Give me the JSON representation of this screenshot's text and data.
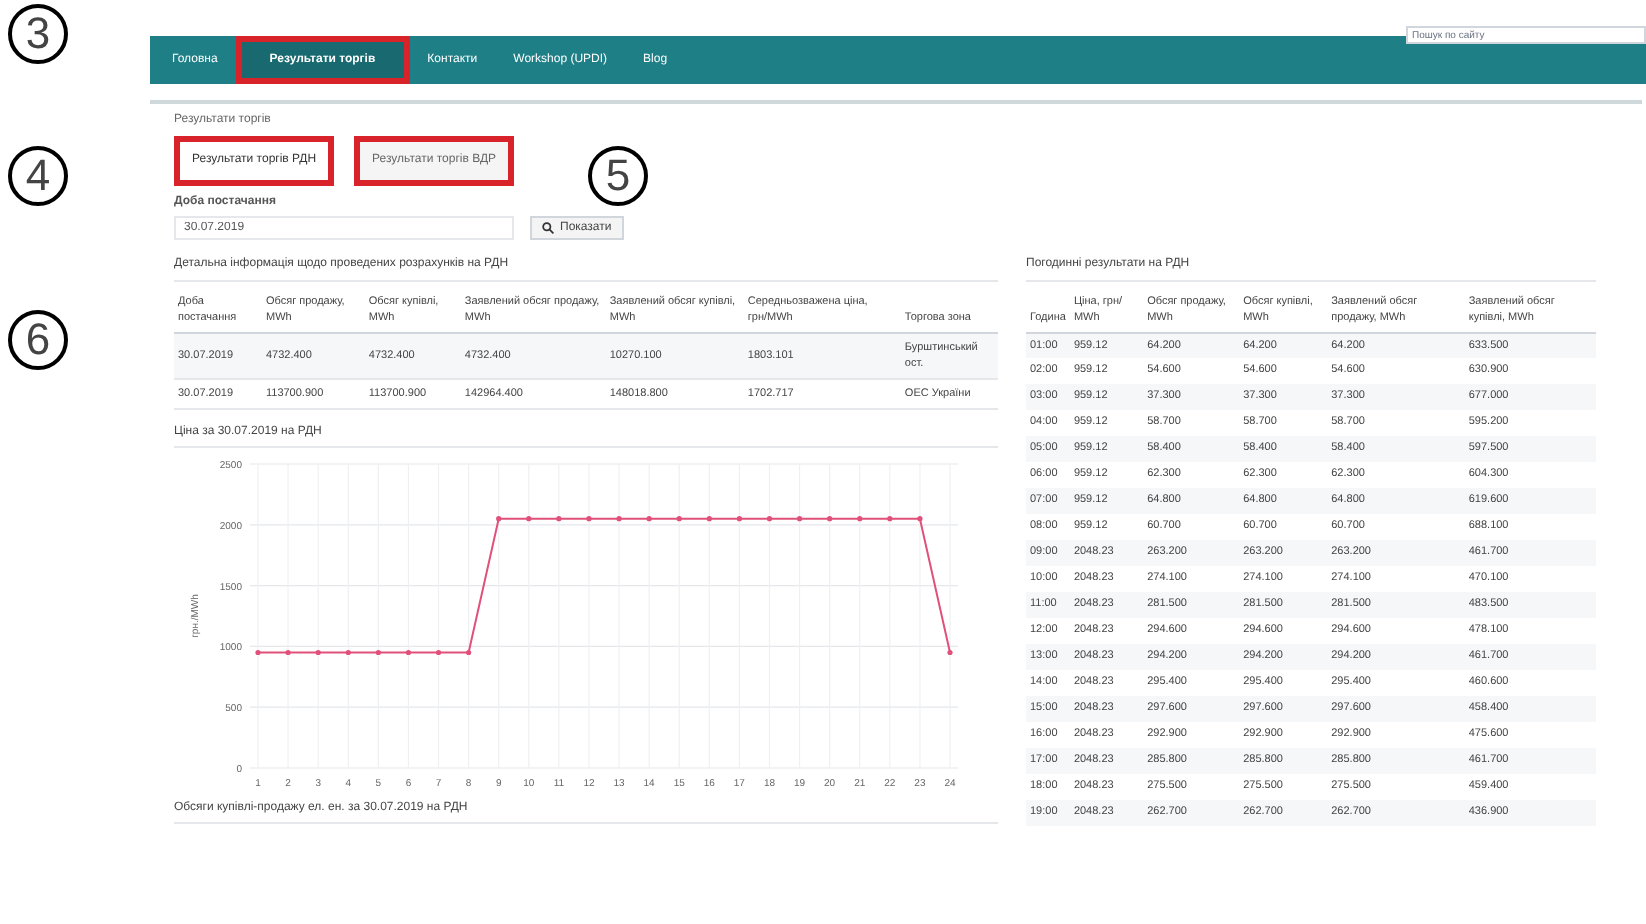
{
  "nav": {
    "items": [
      {
        "label": "Головна",
        "selected": false,
        "highlighted": false
      },
      {
        "label": "Результати торгів",
        "selected": true,
        "highlighted": true
      },
      {
        "label": "Контакти",
        "selected": false,
        "highlighted": false
      },
      {
        "label": "Workshop (UPDI)",
        "selected": false,
        "highlighted": false
      },
      {
        "label": "Blog",
        "selected": false,
        "highlighted": false
      }
    ],
    "search": {
      "placeholder": "Пошук по сайту"
    }
  },
  "annotations": [
    {
      "label": "3"
    },
    {
      "label": "4"
    },
    {
      "label": "5"
    },
    {
      "label": "6"
    }
  ],
  "section_title": "Результати торгів",
  "tabs": [
    {
      "label": "Результати торгів РДН",
      "selected": true,
      "highlighted": true
    },
    {
      "label": "Результати торгів ВДР",
      "selected": false,
      "highlighted": true
    }
  ],
  "date_field": {
    "label": "Доба постачання",
    "value": "30.07.2019"
  },
  "show_button": "Показати",
  "details": {
    "title": "Детальна інформація щодо проведених розрахунків на РДН",
    "columns": [
      "Доба постачання",
      "Обсяг продажу, MWh",
      "Обсяг купівлі, MWh",
      "Заявлений обсяг продажу, MWh",
      "Заявлений обсяг купівлі, MWh",
      "Середньозважена ціна, грн/MWh",
      "Торгова зона"
    ],
    "rows": [
      [
        "30.07.2019",
        "4732.400",
        "4732.400",
        "4732.400",
        "10270.100",
        "1803.101",
        "Бурштинський ост."
      ],
      [
        "30.07.2019",
        "113700.900",
        "113700.900",
        "142964.400",
        "148018.800",
        "1702.717",
        "ОЕС України"
      ]
    ]
  },
  "price_chart": {
    "title": "Ціна за 30.07.2019 на РДН",
    "chart_data": {
      "type": "line",
      "ylabel": "грн./MWh",
      "x": [
        1,
        2,
        3,
        4,
        5,
        6,
        7,
        8,
        9,
        10,
        11,
        12,
        13,
        14,
        15,
        16,
        17,
        18,
        19,
        20,
        21,
        22,
        23,
        24
      ],
      "series": [
        {
          "color": "#e0507a",
          "values": [
            950,
            950,
            950,
            950,
            950,
            950,
            950,
            950,
            2050,
            2050,
            2050,
            2050,
            2050,
            2050,
            2050,
            2050,
            2050,
            2050,
            2050,
            2050,
            2050,
            2050,
            2050,
            950
          ]
        }
      ],
      "xlim": [
        1,
        24
      ],
      "ylim": [
        0,
        2500
      ],
      "grid": true,
      "yticks": [
        0,
        500,
        1000,
        1500,
        2000,
        2500
      ],
      "xticks": [
        1,
        2,
        3,
        4,
        5,
        6,
        7,
        8,
        9,
        10,
        11,
        12,
        13,
        14,
        15,
        16,
        17,
        18,
        19,
        20,
        21,
        22,
        23,
        24
      ]
    }
  },
  "volume_chart_title": "Обсяги купівлі-продажу ел. ен. за 30.07.2019 на РДН",
  "hourly": {
    "title": "Погодинні результати на РДН",
    "columns": [
      "Година",
      "Ціна, грн/ MWh",
      "Обсяг продажу, MWh",
      "Обсяг купівлі, MWh",
      "Заявлений обсяг продажу, MWh",
      "Заявлений обсяг купівлі, MWh"
    ],
    "rows": [
      [
        "01:00",
        "959.12",
        "64.200",
        "64.200",
        "64.200",
        "633.500"
      ],
      [
        "02:00",
        "959.12",
        "54.600",
        "54.600",
        "54.600",
        "630.900"
      ],
      [
        "03:00",
        "959.12",
        "37.300",
        "37.300",
        "37.300",
        "677.000"
      ],
      [
        "04:00",
        "959.12",
        "58.700",
        "58.700",
        "58.700",
        "595.200"
      ],
      [
        "05:00",
        "959.12",
        "58.400",
        "58.400",
        "58.400",
        "597.500"
      ],
      [
        "06:00",
        "959.12",
        "62.300",
        "62.300",
        "62.300",
        "604.300"
      ],
      [
        "07:00",
        "959.12",
        "64.800",
        "64.800",
        "64.800",
        "619.600"
      ],
      [
        "08:00",
        "959.12",
        "60.700",
        "60.700",
        "60.700",
        "688.100"
      ],
      [
        "09:00",
        "2048.23",
        "263.200",
        "263.200",
        "263.200",
        "461.700"
      ],
      [
        "10:00",
        "2048.23",
        "274.100",
        "274.100",
        "274.100",
        "470.100"
      ],
      [
        "11:00",
        "2048.23",
        "281.500",
        "281.500",
        "281.500",
        "483.500"
      ],
      [
        "12:00",
        "2048.23",
        "294.600",
        "294.600",
        "294.600",
        "478.100"
      ],
      [
        "13:00",
        "2048.23",
        "294.200",
        "294.200",
        "294.200",
        "461.700"
      ],
      [
        "14:00",
        "2048.23",
        "295.400",
        "295.400",
        "295.400",
        "460.600"
      ],
      [
        "15:00",
        "2048.23",
        "297.600",
        "297.600",
        "297.600",
        "458.400"
      ],
      [
        "16:00",
        "2048.23",
        "292.900",
        "292.900",
        "292.900",
        "475.600"
      ],
      [
        "17:00",
        "2048.23",
        "285.800",
        "285.800",
        "285.800",
        "461.700"
      ],
      [
        "18:00",
        "2048.23",
        "275.500",
        "275.500",
        "275.500",
        "459.400"
      ],
      [
        "19:00",
        "2048.23",
        "262.700",
        "262.700",
        "262.700",
        "436.900"
      ]
    ]
  }
}
